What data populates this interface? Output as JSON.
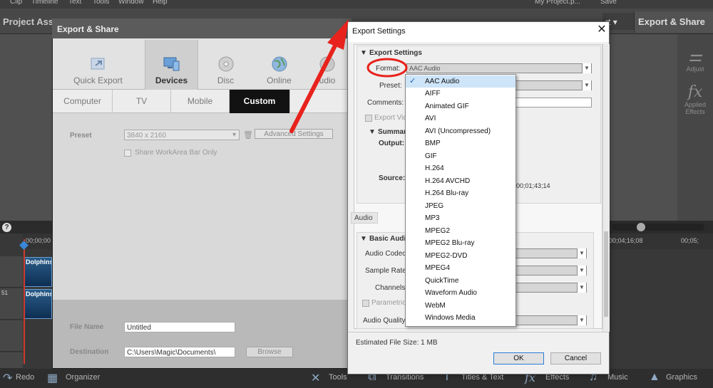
{
  "menubar": {
    "items": [
      "Clip",
      "Timeline",
      "Text",
      "Tools",
      "Window",
      "Help"
    ],
    "project_name": "My Project.p...",
    "save": "Save"
  },
  "app": {
    "project_assets": "Project Ass",
    "expert_label": "rt",
    "export_share_top": "Export & Share",
    "right_panel": {
      "adjust": "Adjust",
      "applied_effects": "Applied Effects",
      "fx": "fx"
    },
    "timeline": {
      "time_start": "00;00;00",
      "time_mid": "00;04;16;08",
      "time_end": "00;05;",
      "clip1": "Dolphins",
      "clip2": "Dolphins",
      "track_num": "51"
    },
    "bottom_bar": {
      "redo": "Redo",
      "organizer": "Organizer",
      "tools": "Tools",
      "transitions": "Transitions",
      "titles": "Titles & Text",
      "effects": "Effects",
      "music": "Music",
      "graphics": "Graphics"
    }
  },
  "export_share": {
    "title": "Export & Share",
    "tabs": [
      {
        "label": "Quick Export",
        "icon": "quick-export-icon"
      },
      {
        "label": "Devices",
        "icon": "devices-icon"
      },
      {
        "label": "Disc",
        "icon": "disc-icon"
      },
      {
        "label": "Online",
        "icon": "globe-icon"
      },
      {
        "label": "udio",
        "icon": "audio-icon"
      }
    ],
    "subtabs": [
      "Computer",
      "TV",
      "Mobile",
      "Custom"
    ],
    "preset_label": "Preset",
    "preset_value": "3840 x 2160",
    "advanced_settings": "Advanced Settings",
    "share_workarea": "Share WorkArea Bar Only",
    "file_name_label": "File Name",
    "file_name_value": "Untitled",
    "destination_label": "Destination",
    "destination_value": "C:\\Users\\Magic\\Documents\\",
    "browse": "Browse"
  },
  "export_settings": {
    "title": "Export Settings",
    "section_title": "Export Settings",
    "format_label": "Format:",
    "format_value": "AAC Audio",
    "preset_label": "Preset:",
    "comments_label": "Comments:",
    "export_video": "Export Vide",
    "summary_label": "Summar",
    "output_label": "Output:",
    "source_label": "Source:",
    "source_time": "00;01;43;14",
    "audio_tab": "Audio",
    "basic_audio": "Basic Audi",
    "audio_codec": "Audio Codec:",
    "sample_rate": "Sample Rate:",
    "channels": "Channels:",
    "parametric": "Parametric S",
    "audio_quality": "Audio Quality:",
    "est_size": "Estimated File Size:  1 MB",
    "ok": "OK",
    "cancel": "Cancel",
    "format_options": [
      "AAC Audio",
      "AIFF",
      "Animated GIF",
      "AVI",
      "AVI (Uncompressed)",
      "BMP",
      "GIF",
      "H.264",
      "H.264 AVCHD",
      "H.264 Blu-ray",
      "JPEG",
      "MP3",
      "MPEG2",
      "MPEG2 Blu-ray",
      "MPEG2-DVD",
      "MPEG4",
      "QuickTime",
      "Waveform Audio",
      "WebM",
      "Windows Media"
    ],
    "selected_format": "AAC Audio",
    "check": "✓"
  },
  "colors": {
    "annotation_red": "#e8221c",
    "accent_blue": "#2a7bd8",
    "custom_tab_bg": "#121212"
  }
}
